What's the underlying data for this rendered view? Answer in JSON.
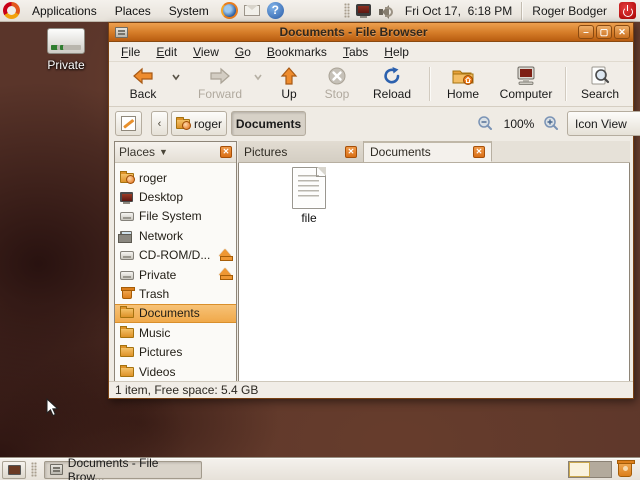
{
  "colors": {
    "accent_orange": "#d47b27",
    "titlebar_top": "#eda04f",
    "titlebar_bottom": "#b85c10",
    "panel_bg": "#ece8e1",
    "selection_orange": "#f0a94a",
    "close_button": "#d96f16"
  },
  "panel": {
    "menus": [
      {
        "label": "Applications"
      },
      {
        "label": "Places"
      },
      {
        "label": "System"
      }
    ],
    "launcher_icons": [
      "firefox-icon",
      "mail-icon",
      "help-icon"
    ],
    "tray": {
      "icons": [
        "network-monitor-icon",
        "volume-icon"
      ],
      "clock": "Fri Oct 17,  6:18 PM",
      "user": "Roger Bodger",
      "power_icon": "power-icon"
    }
  },
  "desktop": {
    "icons": [
      {
        "label": "Private",
        "icon": "drive-icon"
      }
    ]
  },
  "window": {
    "title": "Documents - File Browser",
    "controls": {
      "minimize": "‒",
      "maximize": "▢",
      "close": "✕"
    },
    "menubar": [
      {
        "label": "File"
      },
      {
        "label": "Edit"
      },
      {
        "label": "View"
      },
      {
        "label": "Go"
      },
      {
        "label": "Bookmarks"
      },
      {
        "label": "Tabs"
      },
      {
        "label": "Help"
      }
    ],
    "toolbar": {
      "back": "Back",
      "forward": "Forward",
      "up": "Up",
      "stop": "Stop",
      "reload": "Reload",
      "home": "Home",
      "computer": "Computer",
      "search": "Search"
    },
    "location": {
      "path": [
        {
          "label": "roger"
        },
        {
          "label": "Documents",
          "pressed": true
        }
      ],
      "zoom_level": "100%",
      "view_mode": "Icon View"
    },
    "sidebar": {
      "header": "Places",
      "items": [
        {
          "label": "roger",
          "icon": "home-folder-icon"
        },
        {
          "label": "Desktop",
          "icon": "desktop-icon"
        },
        {
          "label": "File System",
          "icon": "drive-icon"
        },
        {
          "label": "Network",
          "icon": "network-icon"
        },
        {
          "label": "CD-ROM/D...",
          "icon": "cdrom-drive-icon",
          "eject": true
        },
        {
          "label": "Private",
          "icon": "drive-icon",
          "eject": true
        },
        {
          "label": "Trash",
          "icon": "trash-icon"
        },
        {
          "label": "Documents",
          "icon": "folder-icon",
          "selected": true
        },
        {
          "label": "Music",
          "icon": "folder-icon"
        },
        {
          "label": "Pictures",
          "icon": "folder-icon"
        },
        {
          "label": "Videos",
          "icon": "folder-icon"
        }
      ]
    },
    "tabs": [
      {
        "label": "Pictures"
      },
      {
        "label": "Documents",
        "active": true
      }
    ],
    "files": [
      {
        "label": "file",
        "icon": "document-icon"
      }
    ],
    "statusbar": "1 item, Free space: 5.4 GB"
  },
  "taskbar": {
    "task_button": "Documents - File Brow...",
    "workspaces": 2
  }
}
